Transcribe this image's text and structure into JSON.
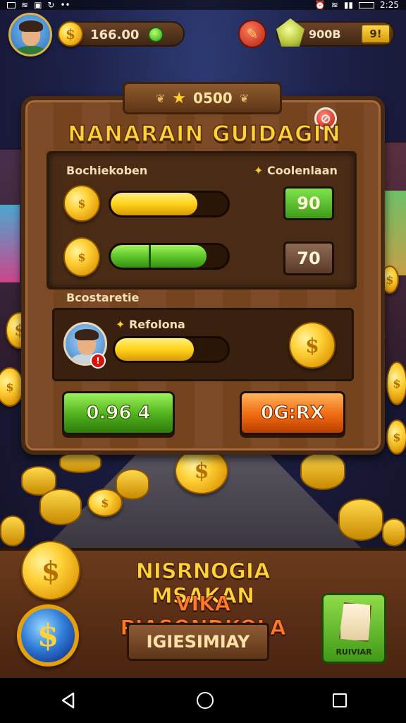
{
  "status_bar": {
    "time": "2:25"
  },
  "hud": {
    "coins": "166.00",
    "gems": "900B",
    "gem_plus_label": "9!"
  },
  "panel": {
    "ribbon_value": "0500",
    "title": "NANARAIN GUIDAGIN",
    "section1": {
      "left_label": "Bochiekoben",
      "right_label": "Coolenlaan",
      "rows": [
        {
          "fill": 0.74,
          "color": "gold",
          "value": "90"
        },
        {
          "fill": 0.82,
          "color": "green",
          "value": "70"
        }
      ]
    },
    "section2": {
      "label": "Bcostaretie",
      "sub_label": "Refolona",
      "fill": 0.7
    },
    "buttons": {
      "primary": "0.96 4",
      "secondary": "0G:RX"
    }
  },
  "banner": {
    "line1": "NISRNOGIA MSAKAN",
    "line2": "VIKA PIASONDKOLA",
    "button": "IGIESIMIAY",
    "reward_label": "RUIVIAR"
  },
  "colors": {
    "gold": "#ffd23a",
    "green": "#5fc72a",
    "orange": "#f06a10",
    "wood": "#7c4a26"
  },
  "icons": [
    "coin-icon",
    "gem-icon",
    "tool-icon",
    "close-icon",
    "star-icon",
    "scroll-icon",
    "back-icon",
    "home-icon",
    "recents-icon"
  ]
}
